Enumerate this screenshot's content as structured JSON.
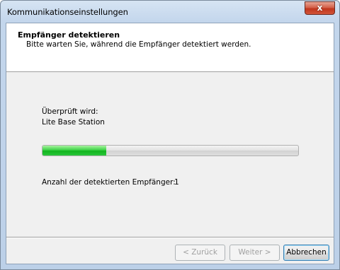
{
  "window": {
    "title": "Kommunikationseinstellungen",
    "close_symbol": "x"
  },
  "header": {
    "title": "Empfänger detektieren",
    "subtitle": "Bitte warten Sie, während die Empfänger detektiert werden."
  },
  "status": {
    "checking_label": "Überprüft wird:",
    "checking_value": "Lite Base Station",
    "progress_fraction": 0.25,
    "count_label": "Anzahl der detektierten Empfänger:",
    "count_value": "1"
  },
  "buttons": {
    "back_label": "< Zurück",
    "next_label": "Weiter >",
    "cancel_label": "Abbrechen"
  },
  "colors": {
    "progress": "#12b41e",
    "close_button": "#c0361d"
  }
}
